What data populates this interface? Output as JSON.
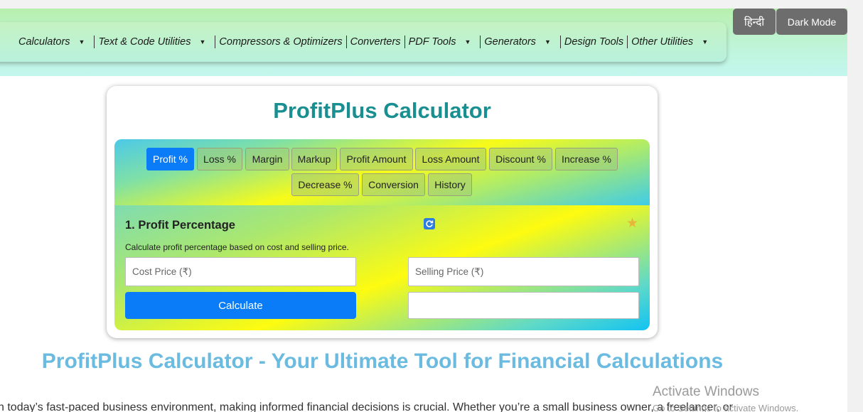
{
  "nav": {
    "items": [
      {
        "label": "Calculators",
        "has_dropdown": true
      },
      {
        "label": "Text & Code Utilities",
        "has_dropdown": true
      },
      {
        "label": "Compressors & Optimizers",
        "has_dropdown": false
      },
      {
        "label": "Converters",
        "has_dropdown": false
      },
      {
        "label": "PDF Tools",
        "has_dropdown": true
      },
      {
        "label": "Generators",
        "has_dropdown": true
      },
      {
        "label": "Design Tools",
        "has_dropdown": false
      },
      {
        "label": "Other Utilities",
        "has_dropdown": true
      }
    ],
    "caret": "▼"
  },
  "top_buttons": {
    "hindi": "हिन्दी",
    "dark_mode": "Dark Mode"
  },
  "card": {
    "title": "ProfitPlus Calculator",
    "tabs": [
      "Profit %",
      "Loss %",
      "Margin",
      "Markup",
      "Profit Amount",
      "Loss Amount",
      "Discount %",
      "Increase %",
      "Decrease %",
      "Conversion",
      "History"
    ],
    "active_tab": "Profit %",
    "form": {
      "title": "1. Profit Percentage",
      "description": "Calculate profit percentage based on cost and selling price.",
      "cost_placeholder": "Cost Price (₹)",
      "selling_placeholder": "Selling Price (₹)",
      "result_value": "",
      "calculate_label": "Calculate",
      "star_glyph": "★",
      "refresh_glyph": "⟳"
    }
  },
  "headline": "ProfitPlus Calculator - Your Ultimate Tool for Financial Calculations",
  "paragraph": "n today’s fast-paced business environment, making informed financial decisions is crucial. Whether you’re a small business owner, a freelancer, or",
  "watermark": {
    "line1": "Activate Windows",
    "line2": "Go to Settings to activate Windows."
  },
  "colors": {
    "accent": "#0a7cf7",
    "title_teal": "#1a8f91",
    "headline_blue": "#6bbbe1",
    "star": "#e6b63a"
  }
}
